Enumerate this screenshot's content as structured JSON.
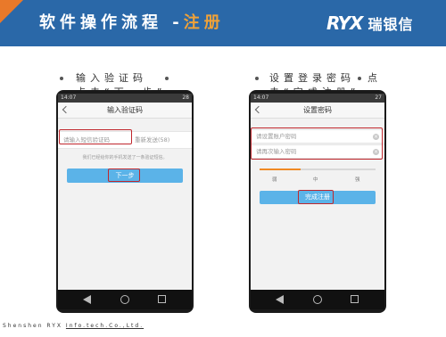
{
  "header": {
    "title_prefix": "软件操作流程 -",
    "title_highlight": "注册",
    "logo_mark": "RYX",
    "logo_name": "瑞银信",
    "colors": {
      "bar": "#2a68a8",
      "corner": "#e9792a",
      "highlight": "#f0a238"
    }
  },
  "steps": {
    "left_line1": "输入验证码",
    "left_line2": "点击“下一步”",
    "right_line1": "设置登录密码",
    "right_line1_tail": "点",
    "right_line2": "击“完成注册”"
  },
  "phone_left": {
    "status_time": "14:07",
    "status_right": "28",
    "nav_title": "输入验证码",
    "code_placeholder": "请输入短信验证码",
    "resend_label": "重新发送(58)",
    "hint": "我们已经给你的手机发送了一条验证短信。",
    "next_button": "下一步",
    "icons": [
      "back-icon",
      "back-softkey-icon",
      "home-softkey-icon",
      "recent-softkey-icon"
    ]
  },
  "phone_right": {
    "status_time": "14:07",
    "status_right": "27",
    "nav_title": "设置密码",
    "password_placeholder": "请设置账户密码",
    "confirm_placeholder": "请再次输入密码",
    "strength_labels": [
      "弱",
      "中",
      "强"
    ],
    "finish_button": "完成注册",
    "icons": [
      "back-icon",
      "clear-icon",
      "back-softkey-icon",
      "home-softkey-icon",
      "recent-softkey-icon"
    ]
  },
  "footer": {
    "prefix": "Shenshen RYX",
    "company": "Info.tech.Co.,Ltd."
  },
  "accent_colors": {
    "highlight_box": "#c0272d",
    "button": "#5bb3e8"
  }
}
